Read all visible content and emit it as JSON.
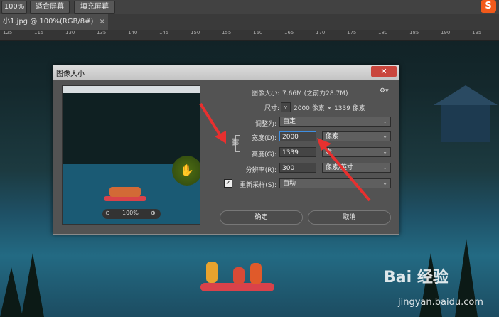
{
  "optbar": {
    "zoom_label": "100%",
    "fit_screen": "适合屏幕",
    "fill_screen": "填充屏幕"
  },
  "tab": {
    "title": "小1.jpg @ 100%(RGB/8#)",
    "close": "×"
  },
  "ruler": [
    "125",
    "115",
    "130",
    "135",
    "140",
    "145",
    "150",
    "155",
    "160",
    "165",
    "170",
    "175",
    "180",
    "185",
    "190",
    "195"
  ],
  "dialog": {
    "title": "图像大小",
    "close": "✕",
    "image_size_label": "图像大小:",
    "image_size_value": "7.66M (之前为28.7M)",
    "dimensions_label": "尺寸:",
    "dimensions_value": "2000 像素 × 1339 像素",
    "fit_to_label": "调整为:",
    "fit_to_value": "自定",
    "width_label": "宽度(D):",
    "width_value": "2000",
    "width_unit": "像素",
    "height_label": "高度(G):",
    "height_value": "1339",
    "height_unit": "素",
    "resolution_label": "分辨率(R):",
    "resolution_value": "300",
    "resolution_unit": "像素/英寸",
    "resample_label": "重新采样(S):",
    "resample_checked": true,
    "resample_value": "自动",
    "zoom": "100%",
    "ok": "确定",
    "cancel": "取消"
  },
  "watermark": {
    "brand": "Bai 经验",
    "url": "jingyan.baidu.com"
  },
  "colors": {
    "arrow": "#e8302f",
    "accent": "#3f8ee0"
  }
}
